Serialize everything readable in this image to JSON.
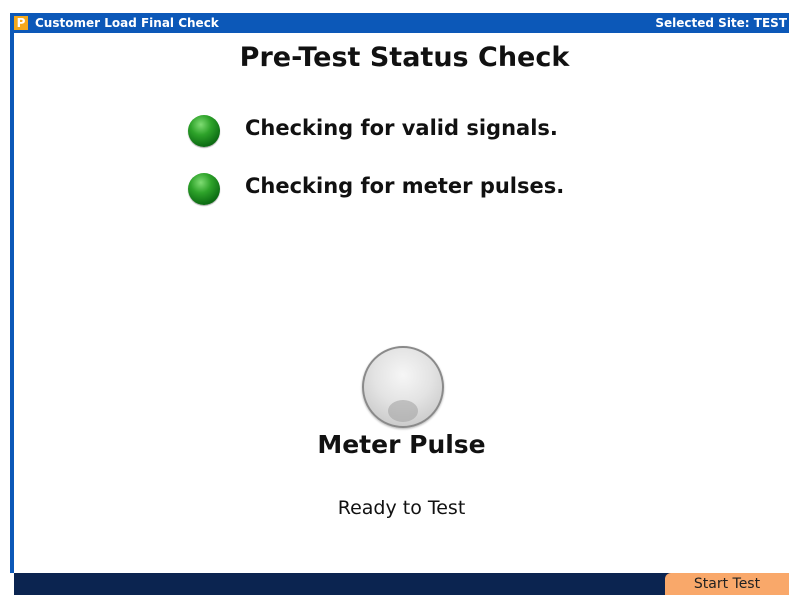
{
  "window": {
    "title": "Customer Load Final Check",
    "site_label": "Selected Site: TEST",
    "logo_glyph": "P",
    "accent_color": "#0c58b8"
  },
  "main": {
    "heading": "Pre-Test Status Check",
    "checks": [
      {
        "label": "Checking for valid signals.",
        "status_color": "#1f8a22"
      },
      {
        "label": "Checking for meter pulses.",
        "status_color": "#1f8a22"
      }
    ],
    "pulse": {
      "title": "Meter Pulse",
      "status": "Ready to Test",
      "lamp_color": "#d9d9d9"
    }
  },
  "footer": {
    "start_button_label": "Start Test",
    "bar_color": "#0b2450",
    "button_color": "#f9a86a"
  }
}
